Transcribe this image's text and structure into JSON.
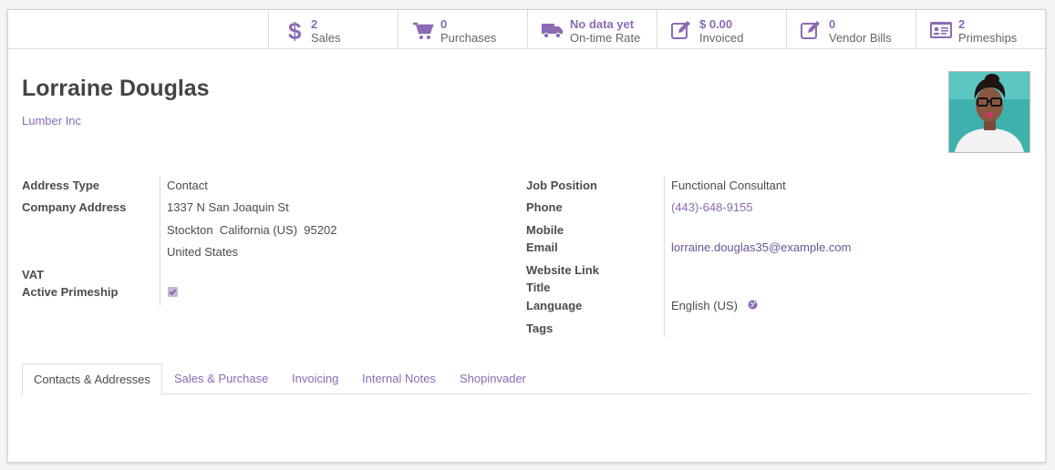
{
  "stat_buttons": [
    {
      "value": "2",
      "label": "Sales",
      "icon": "dollar-icon"
    },
    {
      "value": "0",
      "label": "Purchases",
      "icon": "shopping-cart-icon"
    },
    {
      "value": "No data yet",
      "label": "On-time Rate",
      "icon": "truck-icon"
    },
    {
      "value": "$ 0.00",
      "label": "Invoiced",
      "icon": "edit-icon"
    },
    {
      "value": "0",
      "label": "Vendor Bills",
      "icon": "edit-icon"
    },
    {
      "value": "2",
      "label": "Primeships",
      "icon": "id-card-icon"
    }
  ],
  "partner": {
    "name": "Lorraine Douglas",
    "company": "Lumber Inc"
  },
  "left_fields": {
    "address_type": {
      "label": "Address Type",
      "value": "Contact"
    },
    "company_address": {
      "label": "Company Address",
      "street": "1337 N San Joaquin St",
      "city_line": "Stockton  California (US)  95202",
      "country": "United States"
    },
    "vat": {
      "label": "VAT",
      "value": ""
    },
    "active_primeship": {
      "label": "Active Primeship",
      "checked": true
    }
  },
  "right_fields": {
    "job_position": {
      "label": "Job Position",
      "value": "Functional Consultant"
    },
    "phone": {
      "label": "Phone",
      "value": "(443)-648-9155"
    },
    "mobile": {
      "label": "Mobile",
      "value": ""
    },
    "email": {
      "label": "Email",
      "value": "lorraine.douglas35@example.com"
    },
    "website": {
      "label": "Website Link",
      "value": ""
    },
    "title": {
      "label": "Title",
      "value": ""
    },
    "language": {
      "label": "Language",
      "value": "English (US)"
    },
    "tags": {
      "label": "Tags",
      "value": ""
    }
  },
  "tabs": [
    {
      "label": "Contacts & Addresses",
      "active": true
    },
    {
      "label": "Sales & Purchase",
      "active": false
    },
    {
      "label": "Invoicing",
      "active": false
    },
    {
      "label": "Internal Notes",
      "active": false
    },
    {
      "label": "Shopinvader",
      "active": false
    }
  ],
  "colors": {
    "accent": "#8a6bb3",
    "text": "#4c4c4c",
    "border": "#dcdcdc"
  }
}
